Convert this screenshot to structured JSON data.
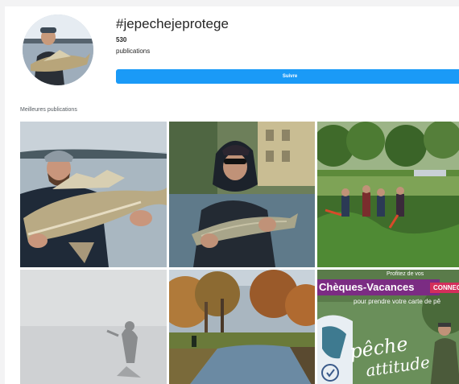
{
  "header": {
    "hashtag": "#jepechejeprotege",
    "post_count": "530",
    "post_count_label": "publications",
    "follow_label": "Suivre"
  },
  "top_posts": {
    "section_label": "Meilleures publications",
    "tiles": [
      {
        "subject": "Man holding large zander on a lake"
      },
      {
        "subject": "Angler in hood holding a trout in a river"
      },
      {
        "subject": "Group doing river bank maintenance"
      },
      {
        "subject": "Angler in fog"
      },
      {
        "subject": "Autumn river landscape"
      },
      {
        "subject": "Chèques-Vacances advertisement",
        "headline": "Chèques-Vacances",
        "badge": "CONNEC",
        "top_line": "Profitez de vos",
        "sub_line": "pour prendre votre carte de pê",
        "script_1": "pêche",
        "script_2": "attitude"
      }
    ]
  },
  "colors": {
    "follow_button": "#1a9af7",
    "promo_purple": "#7b2c83",
    "promo_badge": "#d42e5b"
  }
}
